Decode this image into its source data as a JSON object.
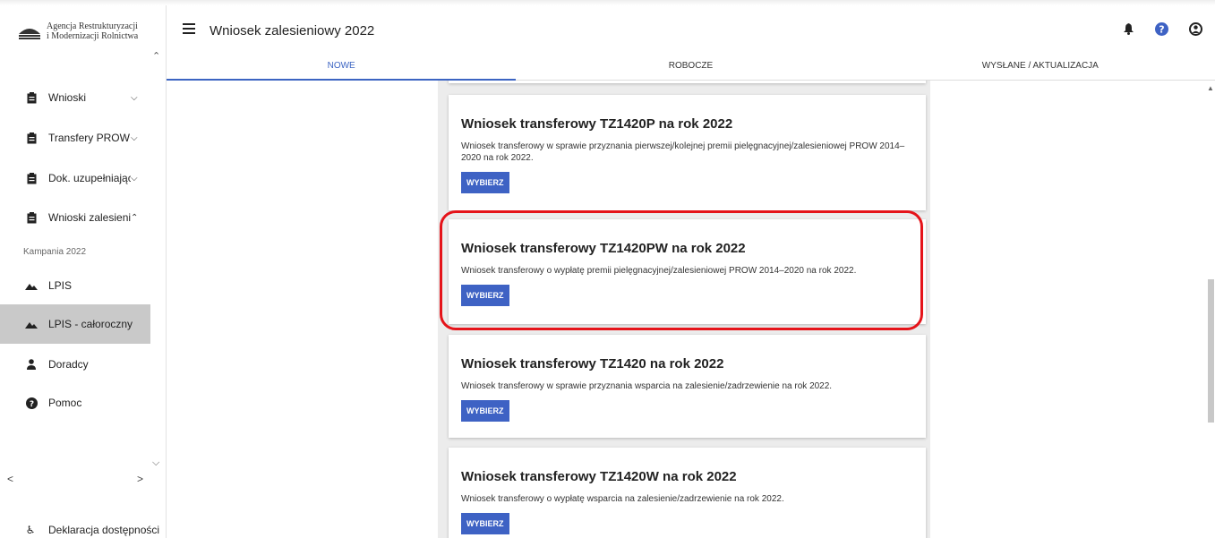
{
  "logo": {
    "line1": "Agencja Restrukturyzacji",
    "line2": "i Modernizacji Rolnictwa"
  },
  "header": {
    "title": "Wniosek zalesieniowy 2022"
  },
  "tabs": [
    {
      "label": "NOWE",
      "active": true
    },
    {
      "label": "ROBOCZE",
      "active": false
    },
    {
      "label": "WYSŁANE / AKTUALIZACJA",
      "active": false
    }
  ],
  "sidebar": {
    "items": [
      {
        "label": "Wnioski",
        "icon": "clipboard-icon",
        "chevron": "down"
      },
      {
        "label": "Transfery PROW",
        "icon": "clipboard-icon",
        "chevron": "down"
      },
      {
        "label": "Dok. uzupełniające",
        "icon": "clipboard-icon",
        "chevron": "down"
      },
      {
        "label": "Wnioski zalesieniowe",
        "icon": "clipboard-icon",
        "chevron": "up"
      },
      {
        "label": "LPIS",
        "icon": "mountain-icon"
      },
      {
        "label": "LPIS - całoroczny",
        "icon": "mountain-icon",
        "active": true
      },
      {
        "label": "Doradcy",
        "icon": "person-icon"
      },
      {
        "label": "Pomoc",
        "icon": "help-icon"
      }
    ],
    "sub_label": "Kampania 2022",
    "accessibility": "Deklaracja dostępności"
  },
  "cards": [
    {
      "title": "Wniosek transferowy TZ1420P na rok 2022",
      "desc": "Wniosek transferowy w sprawie przyznania pierwszej/kolejnej premii pielęgnacyjnej/zalesieniowej PROW 2014–2020 na rok 2022.",
      "button": "WYBIERZ"
    },
    {
      "title": "Wniosek transferowy TZ1420PW na rok 2022",
      "desc": "Wniosek transferowy o wypłatę premii pielęgnacyjnej/zalesieniowej PROW 2014–2020 na rok 2022.",
      "button": "WYBIERZ"
    },
    {
      "title": "Wniosek transferowy TZ1420 na rok 2022",
      "desc": "Wniosek transferowy w sprawie przyznania wsparcia na zalesienie/zadrzewienie na rok 2022.",
      "button": "WYBIERZ"
    },
    {
      "title": "Wniosek transferowy TZ1420W na rok 2022",
      "desc": "Wniosek transferowy o wypłatę wsparcia na zalesienie/zadrzewienie na rok 2022.",
      "button": "WYBIERZ"
    }
  ],
  "colors": {
    "accent": "#3e62c4",
    "highlight": "#e5141a",
    "active_nav": "#c9c9c9"
  }
}
